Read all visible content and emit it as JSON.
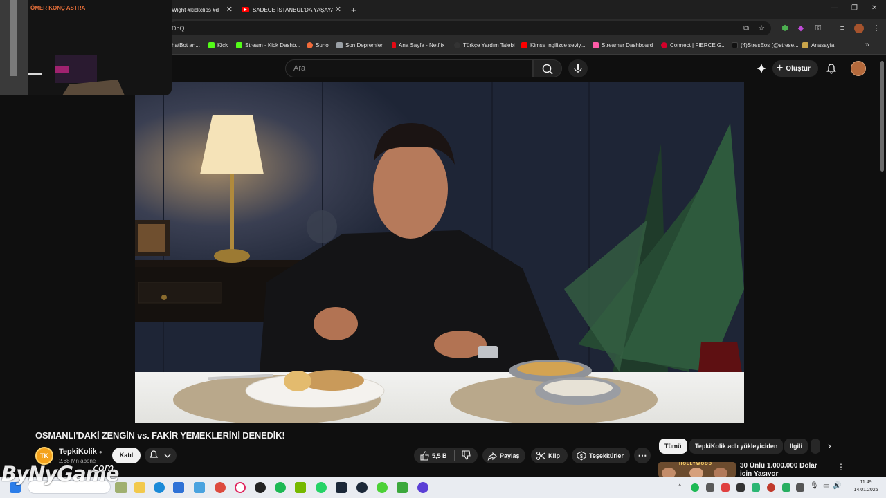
{
  "browser": {
    "tabs": [
      {
        "title": "Wight #kickclips #d"
      },
      {
        "title": "SADECE İSTANBUL'DA YAŞAYAN"
      }
    ],
    "url": "DbQ",
    "bookmarks": [
      {
        "label": "hatBot an...",
        "color": "#555555"
      },
      {
        "label": "Kick",
        "color": "#53fc18"
      },
      {
        "label": "Stream - Kick Dashb...",
        "color": "#53fc18"
      },
      {
        "label": "Suno",
        "color": "#f26b3a"
      },
      {
        "label": "Son Depremler",
        "color": "#9aa0a6"
      },
      {
        "label": "Ana Sayfa - Netflix",
        "color": "#e50914"
      },
      {
        "label": "Türkçe Yardım Talebi",
        "color": "#222222"
      },
      {
        "label": "Kimse ingilizce seviy...",
        "color": "#ff0000"
      },
      {
        "label": "Streamer Dashboard",
        "color": "#ff5ca8"
      },
      {
        "label": "Connect | FIERCE G...",
        "color": "#d4002a"
      },
      {
        "label": "(4)StresEos (@strese...",
        "color": "#111111"
      },
      {
        "label": "Anasayfa",
        "color": "#c9a44a"
      }
    ]
  },
  "webcam": {
    "overlay_text": "ÖMER KONÇ ASTRA"
  },
  "youtube": {
    "search_placeholder": "Ara",
    "create_label": "Oluştur",
    "video": {
      "title": "OSMANLI'DAKİ ZENGİN vs. FAKİR YEMEKLERİNİ DENEDİK!",
      "channel_initials": "TK",
      "channel": "TepkiKolik",
      "subscribers": "2,68 Mn abone",
      "join_label": "Katıl",
      "likes": "5,5 B",
      "share_label": "Paylaş",
      "clip_label": "Klip",
      "thanks_label": "Teşekkürler"
    },
    "chips": [
      {
        "label": "Tümü",
        "active": true
      },
      {
        "label": "TepkiKolik adlı yükleyiciden",
        "active": false
      },
      {
        "label": "İlgili",
        "active": false
      }
    ],
    "recommended": [
      {
        "title": "30 Ünlü 1.000.000 Dolar için Yaşıyor",
        "thumb_text": "HOLLYWOOD"
      }
    ]
  },
  "overlay_watermark": {
    "main": "ByNyGame",
    "suffix": ".com"
  },
  "taskbar": {
    "time": "11:49",
    "date": "14.01.2026"
  }
}
